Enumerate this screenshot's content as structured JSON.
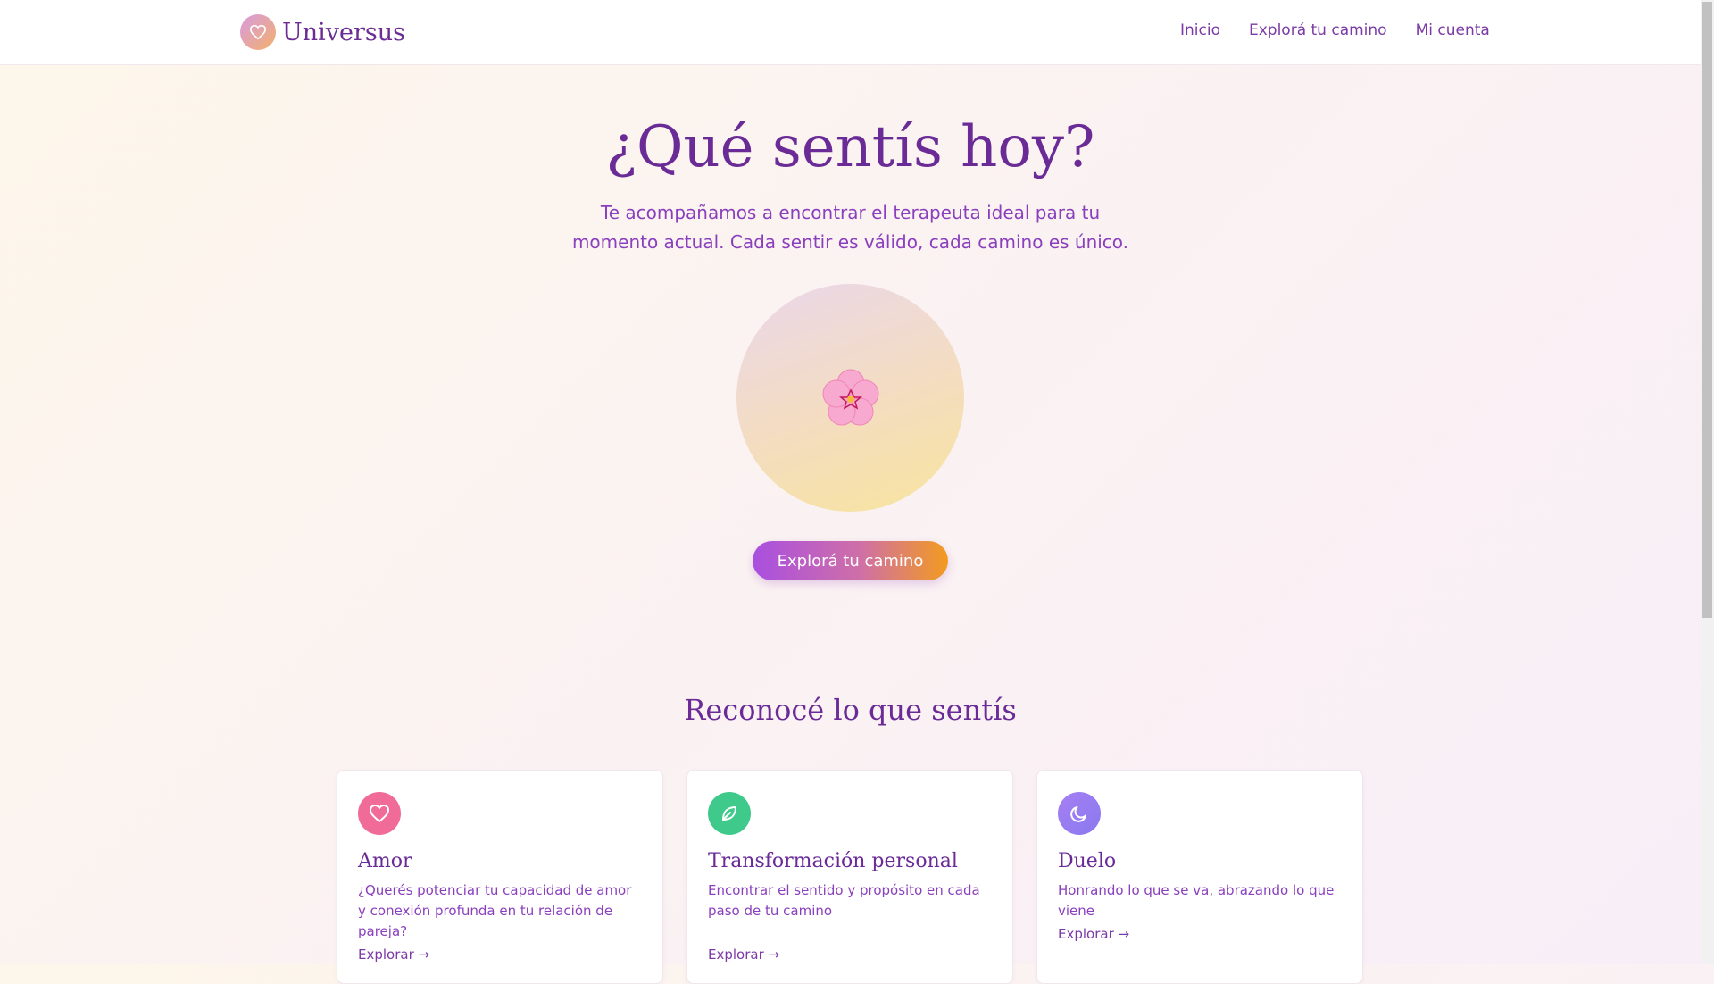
{
  "header": {
    "brand": "Universus",
    "nav": [
      "Inicio",
      "Explorá tu camino",
      "Mi cuenta"
    ]
  },
  "hero": {
    "title": "¿Qué sentís hoy?",
    "subtitle": "Te acompañamos a encontrar el terapeuta ideal para tu momento actual. Cada sentir es válido, cada camino es único.",
    "flower_icon": "🌸",
    "cta_label": "Explorá tu camino"
  },
  "section": {
    "title": "Reconocé lo que sentís"
  },
  "cards": [
    {
      "title": "Amor",
      "description": "¿Querés potenciar tu capacidad de amor y conexión profunda en tu relación de pareja?",
      "link": "Explorar →",
      "icon": "heart-icon",
      "color": "#f06b97"
    },
    {
      "title": "Transformación personal",
      "description": "Encontrar el sentido y propósito en cada paso de tu camino",
      "link": "Explorar →",
      "icon": "leaf-icon",
      "color": "#3fc98a"
    },
    {
      "title": "Duelo",
      "description": "Honrando lo que se va, abrazando lo que viene",
      "link": "Explorar →",
      "icon": "moon-icon",
      "color": "#9b7cf0"
    }
  ]
}
